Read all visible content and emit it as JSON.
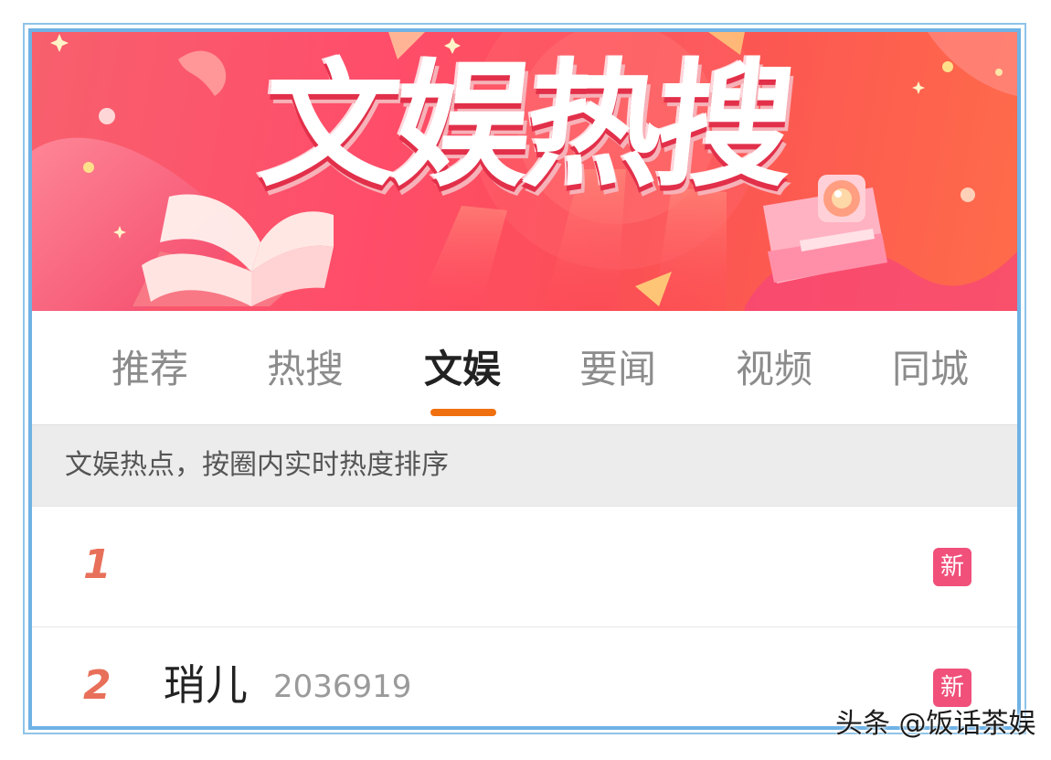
{
  "banner": {
    "title": "文娱热搜",
    "colors": {
      "primary": "#ff4d6a",
      "accent": "#ff6c4a"
    },
    "decor": [
      "open-book-illustration",
      "camera-illustration",
      "sparkle-icon"
    ]
  },
  "tabs": [
    {
      "label": "推荐",
      "active": false
    },
    {
      "label": "热搜",
      "active": false
    },
    {
      "label": "文娱",
      "active": true
    },
    {
      "label": "要闻",
      "active": false
    },
    {
      "label": "视频",
      "active": false
    },
    {
      "label": "同城",
      "active": false
    }
  ],
  "tab_indicator_color": "#f07010",
  "info": {
    "text": "文娱热点，按圈内实时热度排序"
  },
  "list": [
    {
      "rank": "1",
      "title": "",
      "heat": "",
      "badge": "新"
    },
    {
      "rank": "2",
      "title": "琑儿",
      "heat": "2036919",
      "badge": "新"
    }
  ],
  "rank_color": "#e8705a",
  "badge_color": "#f0507a",
  "watermark": "头条 @饭话茶娱"
}
